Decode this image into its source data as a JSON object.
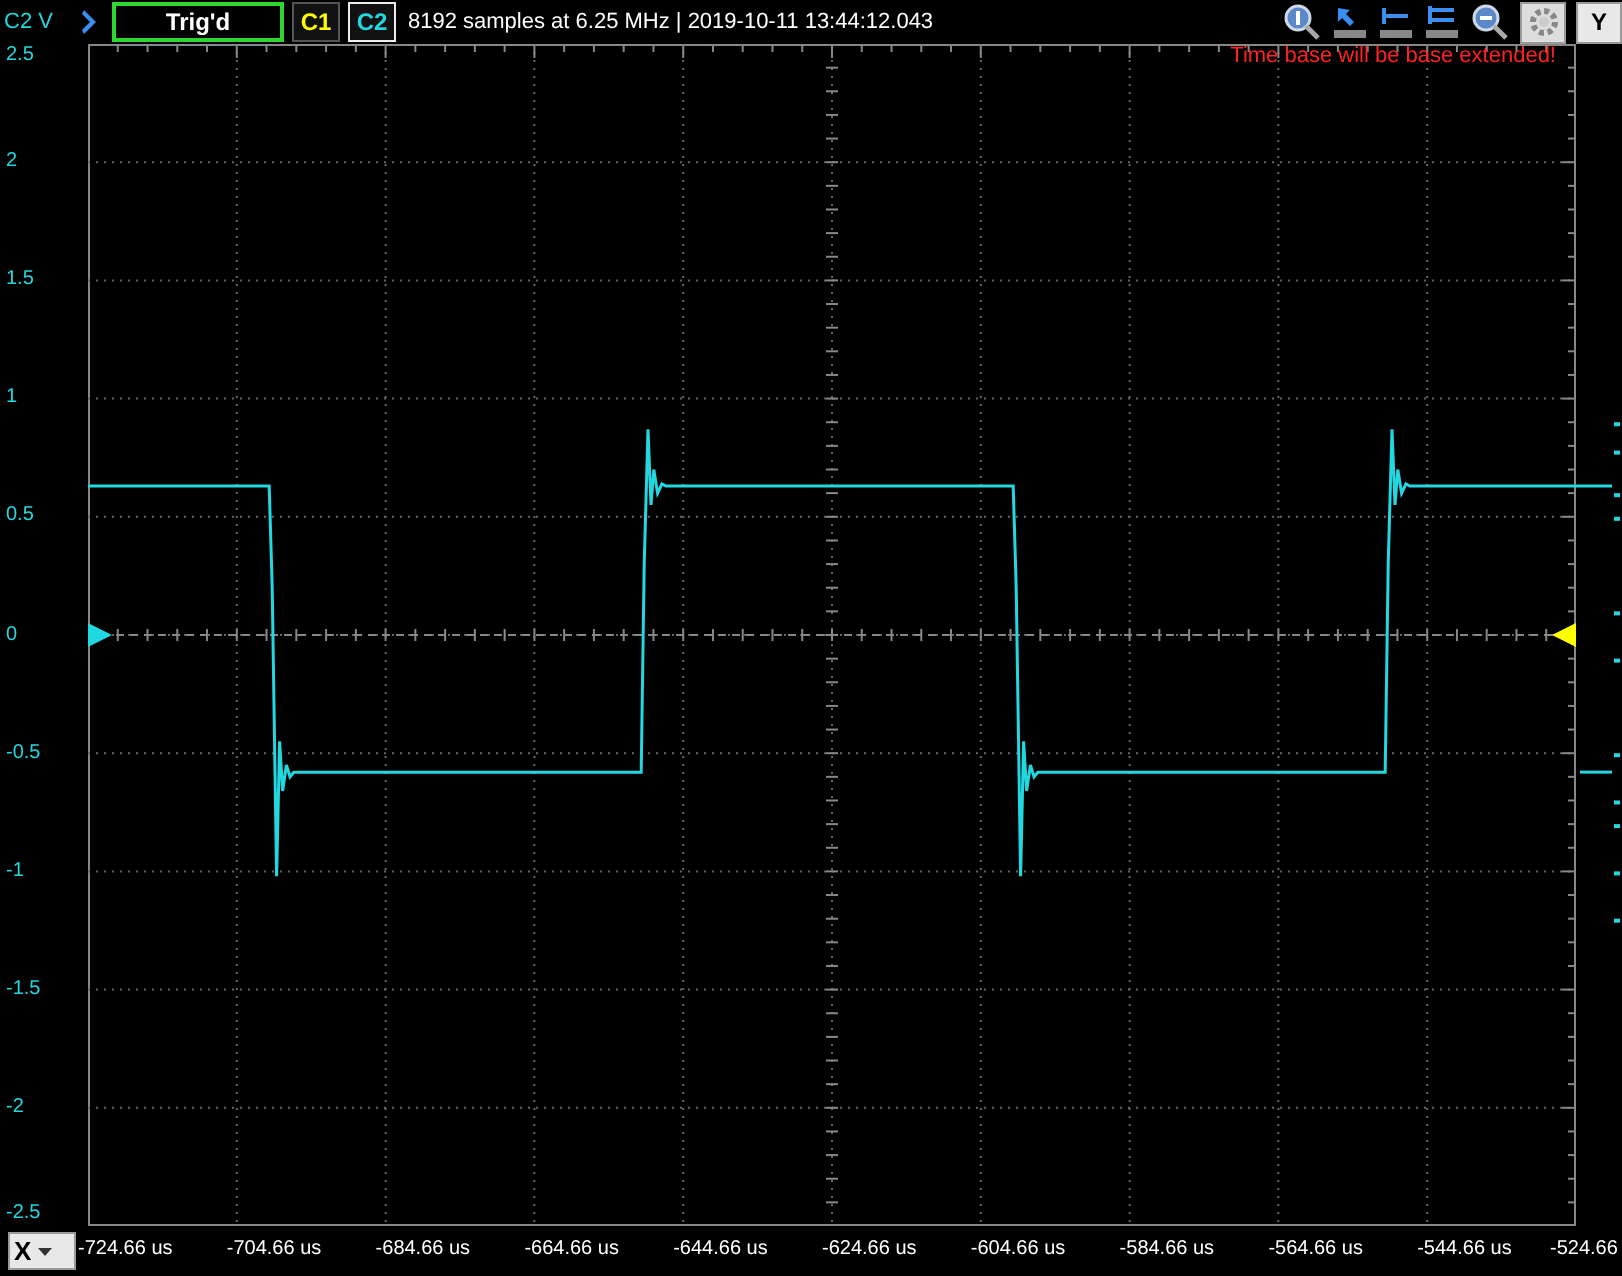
{
  "channel_label": "C2 V",
  "trigger": {
    "status": "Trig'd"
  },
  "channels": [
    {
      "label": "C1",
      "color": "#ffff00",
      "selected": false
    },
    {
      "label": "C2",
      "color": "#22d8e0",
      "selected": true
    }
  ],
  "acquisition_info": "8192 samples at 6.25 MHz | 2019-10-11 13:44:12.043",
  "warning": "Time base will be base extended!",
  "y_axis_button": "Y",
  "x_axis_button": "X",
  "plot": {
    "y_labels": [
      "2.5",
      "2",
      "1.5",
      "1",
      "0.5",
      "0",
      "-0.5",
      "-1",
      "-1.5",
      "-2",
      "-2.5"
    ],
    "x_labels": [
      "-724.66 us",
      "-704.66 us",
      "-684.66 us",
      "-664.66 us",
      "-644.66 us",
      "-624.66 us",
      "-604.66 us",
      "-584.66 us",
      "-564.66 us",
      "-544.66 us",
      "-524.66"
    ]
  }
}
